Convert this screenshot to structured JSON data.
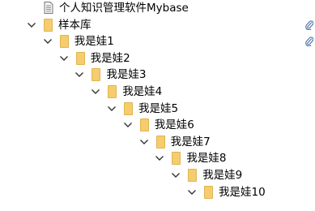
{
  "icons": {
    "folder_color": "#f5cd6e",
    "folder_edge": "#e0b54f",
    "doc_edge": "#777777",
    "doc_fill": "#f2f2f2",
    "chevron_color": "#333333",
    "attach_color": "#4a6fa5",
    "chevron": "chevron-down-icon",
    "folder": "folder-icon",
    "document": "document-icon",
    "attachment": "paperclip-icon"
  },
  "tree": {
    "items": [
      {
        "label": "个人知识管理软件Mybase",
        "depth": 0,
        "type": "document",
        "expanded": false,
        "has_attachment": false
      },
      {
        "label": "样本库",
        "depth": 0,
        "type": "folder",
        "expanded": true,
        "has_attachment": true
      },
      {
        "label": "我是娃1",
        "depth": 1,
        "type": "folder",
        "expanded": true,
        "has_attachment": true
      },
      {
        "label": "我是娃2",
        "depth": 2,
        "type": "folder",
        "expanded": true,
        "has_attachment": false
      },
      {
        "label": "我是娃3",
        "depth": 3,
        "type": "folder",
        "expanded": true,
        "has_attachment": false
      },
      {
        "label": "我是娃4",
        "depth": 4,
        "type": "folder",
        "expanded": true,
        "has_attachment": false
      },
      {
        "label": "我是娃5",
        "depth": 5,
        "type": "folder",
        "expanded": true,
        "has_attachment": false
      },
      {
        "label": "我是娃6",
        "depth": 6,
        "type": "folder",
        "expanded": true,
        "has_attachment": false
      },
      {
        "label": "我是娃7",
        "depth": 7,
        "type": "folder",
        "expanded": true,
        "has_attachment": false
      },
      {
        "label": "我是娃8",
        "depth": 8,
        "type": "folder",
        "expanded": true,
        "has_attachment": false
      },
      {
        "label": "我是娃9",
        "depth": 9,
        "type": "folder",
        "expanded": true,
        "has_attachment": false
      },
      {
        "label": "我是娃10",
        "depth": 10,
        "type": "folder",
        "expanded": true,
        "has_attachment": false
      }
    ]
  }
}
